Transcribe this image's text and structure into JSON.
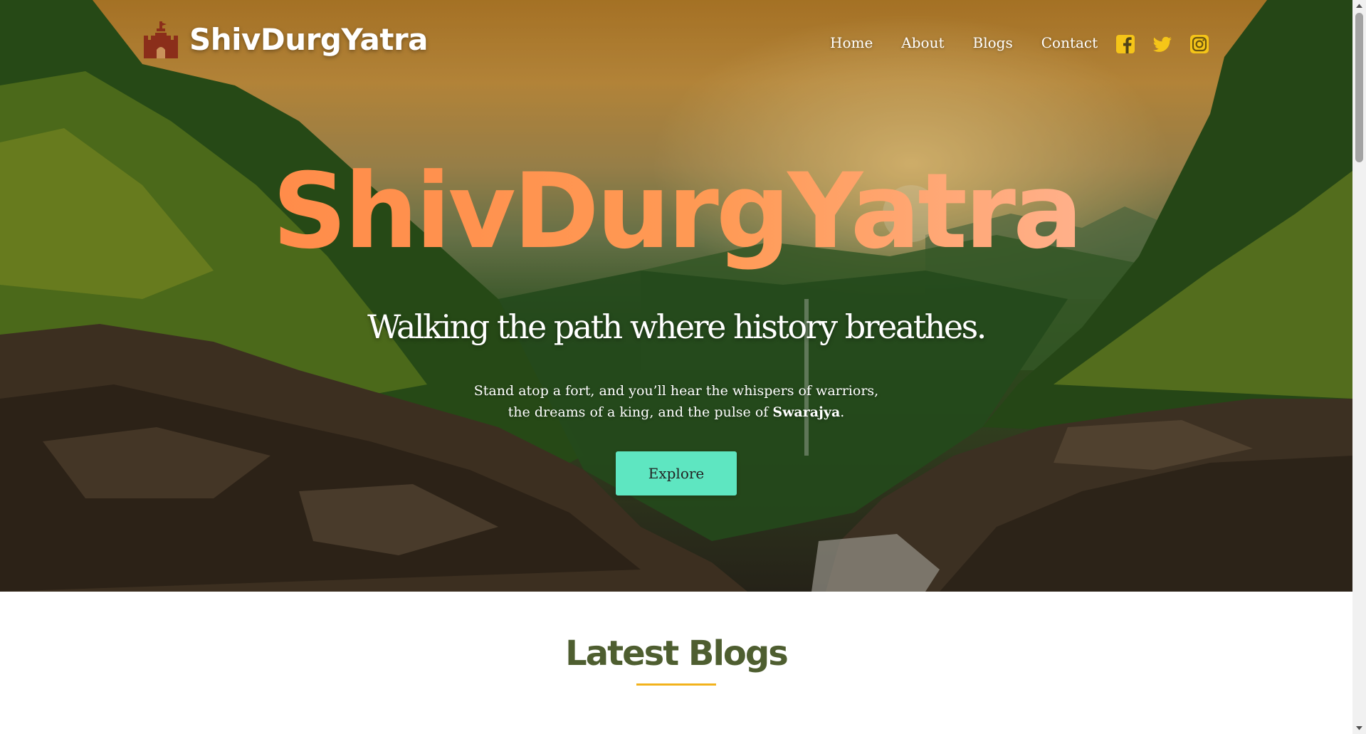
{
  "brand": {
    "name": "ShivDurgYatra",
    "icon": "castle-icon",
    "icon_color": "#8b2e1a"
  },
  "nav": {
    "links": [
      {
        "label": "Home"
      },
      {
        "label": "About"
      },
      {
        "label": "Blogs"
      },
      {
        "label": "Contact"
      }
    ],
    "socials": [
      {
        "icon": "facebook-icon"
      },
      {
        "icon": "twitter-icon"
      },
      {
        "icon": "instagram-icon"
      }
    ],
    "social_color": "#f5c518"
  },
  "hero": {
    "title": "ShivDurgYatra",
    "subtitle": "Walking the path where history breathes.",
    "description_line1": "Stand atop a fort, and you’ll hear the whispers of warriors,",
    "description_line2_prefix": "the dreams of a king, and the pulse of ",
    "description_line2_bold": "Swarajya",
    "description_line2_suffix": ".",
    "cta_label": "Explore",
    "cta_color": "#5ee6c1",
    "title_gradient": [
      "#ff8c4a",
      "#ffb08a"
    ]
  },
  "latest_blogs": {
    "title": "Latest Blogs",
    "title_color": "#4e5e30",
    "underline_color": "#f2b21c"
  }
}
